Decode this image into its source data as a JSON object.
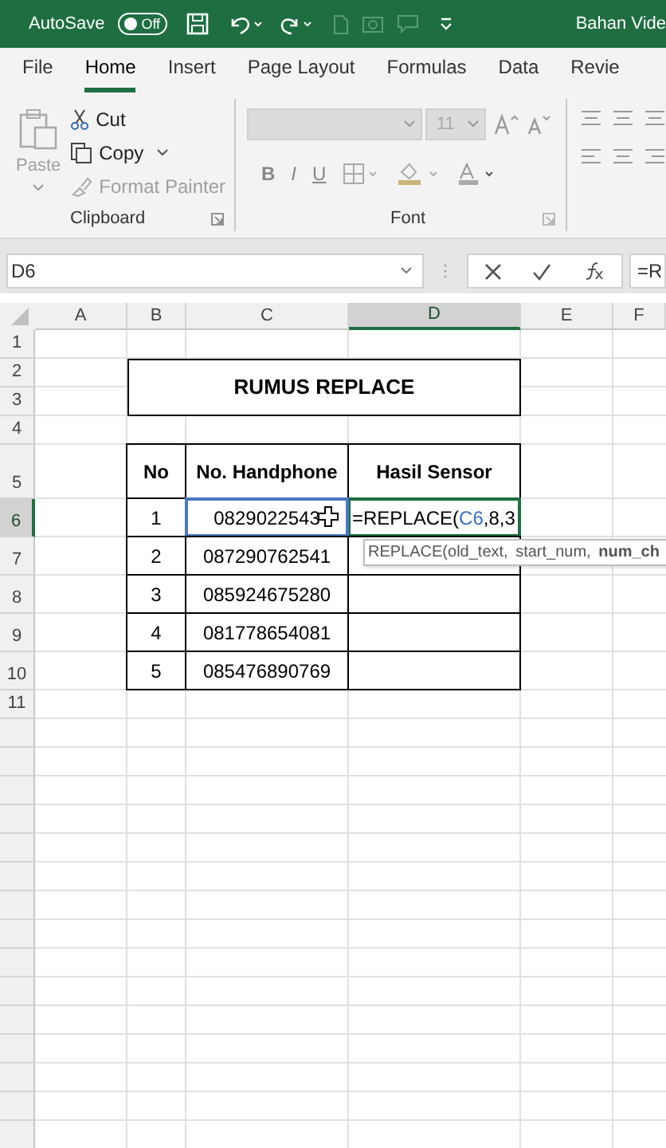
{
  "title_bar": {
    "autosave_label": "AutoSave",
    "autosave_toggle": {
      "label": "Off",
      "on": false
    },
    "document_title": "Bahan Vide"
  },
  "ribbon_tabs": [
    {
      "label": "File",
      "selected": false
    },
    {
      "label": "Home",
      "selected": true
    },
    {
      "label": "Insert",
      "selected": false
    },
    {
      "label": "Page Layout",
      "selected": false
    },
    {
      "label": "Formulas",
      "selected": false
    },
    {
      "label": "Data",
      "selected": false
    },
    {
      "label": "Revie",
      "selected": false
    }
  ],
  "clipboard_group": {
    "paste": {
      "label": "Paste",
      "disabled": true
    },
    "cut": {
      "label": "Cut",
      "disabled": false
    },
    "copy": {
      "label": "Copy",
      "disabled": false
    },
    "format_painter": {
      "label": "Format Painter",
      "disabled": true
    },
    "group_label": "Clipboard"
  },
  "font_group": {
    "font_size": "11",
    "bold": "B",
    "italic": "I",
    "underline": "U",
    "group_label": "Font"
  },
  "formula_bar": {
    "name_box": "D6",
    "formula": "=R"
  },
  "columns": [
    {
      "label": "A",
      "selected": false
    },
    {
      "label": "B",
      "selected": false
    },
    {
      "label": "C",
      "selected": false
    },
    {
      "label": "D",
      "selected": true
    },
    {
      "label": "E",
      "selected": false
    },
    {
      "label": "F",
      "selected": false
    }
  ],
  "row_headers": [
    {
      "label": "1",
      "selected": false
    },
    {
      "label": "2",
      "selected": false
    },
    {
      "label": "3",
      "selected": false
    },
    {
      "label": "4",
      "selected": false
    },
    {
      "label": "5",
      "selected": false
    },
    {
      "label": "6",
      "selected": true
    },
    {
      "label": "7",
      "selected": false
    },
    {
      "label": "8",
      "selected": false
    },
    {
      "label": "9",
      "selected": false
    },
    {
      "label": "10",
      "selected": false
    },
    {
      "label": "11",
      "selected": false
    }
  ],
  "sheet": {
    "title": "RUMUS REPLACE",
    "headers": [
      "No",
      "No. Handphone",
      "Hasil Sensor"
    ],
    "rows": [
      {
        "no": "1",
        "phone": "0829022543",
        "phone_selected": true,
        "result_editing": true,
        "formula_parts": [
          {
            "kind": "plain",
            "text": "=REPLACE("
          },
          {
            "kind": "reference",
            "text": "C6"
          },
          {
            "kind": "plain",
            "text": ",8,3"
          }
        ]
      },
      {
        "no": "2",
        "phone": "087290762541",
        "phone_selected": false,
        "result_editing": false
      },
      {
        "no": "3",
        "phone": "085924675280",
        "phone_selected": false,
        "result_editing": false
      },
      {
        "no": "4",
        "phone": "081778654081",
        "phone_selected": false,
        "result_editing": false
      },
      {
        "no": "5",
        "phone": "085476890769",
        "phone_selected": false,
        "result_editing": false
      }
    ],
    "tooltip": "REPLACE(old_text, start_num, **num_ch**"
  }
}
